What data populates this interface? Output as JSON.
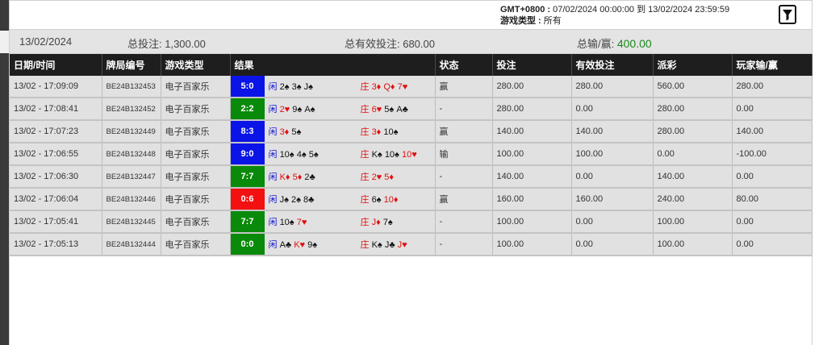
{
  "header": {
    "timezone_label": "GMT+0800 :",
    "date_range": "07/02/2024 00:00:00 到 13/02/2024 23:59:59",
    "game_type_label": "游戏类型 :",
    "game_type_value": "所有"
  },
  "summary": {
    "date": "13/02/2024",
    "total_bet": "总投注: 1,300.00",
    "total_valid_bet": "总有效投注: 680.00",
    "total_winloss_label": "总输/赢:",
    "total_winloss_value": "400.00"
  },
  "columns": [
    "日期/时间",
    "牌局编号",
    "游戏类型",
    "结果",
    "状态",
    "投注",
    "有效投注",
    "派彩",
    "玩家输/赢"
  ],
  "colors": {
    "blue": "#0a14e6",
    "green": "#0a8a0a",
    "red": "#f21010"
  },
  "rows": [
    {
      "time": "13/02 - 17:09:09",
      "round": "BE24B132453",
      "game": "电子百家乐",
      "score": "5:0",
      "scoreColor": "blue",
      "player": [
        {
          "t": "闲",
          "c": "p"
        },
        {
          "t": "2♠",
          "c": "b"
        },
        {
          "t": "3♠",
          "c": "b"
        },
        {
          "t": "J♠",
          "c": "b"
        }
      ],
      "banker": [
        {
          "t": "庄",
          "c": "r"
        },
        {
          "t": "3♦",
          "c": "r"
        },
        {
          "t": "Q♦",
          "c": "r"
        },
        {
          "t": "7♥",
          "c": "r"
        }
      ],
      "status": "赢",
      "statusType": "win",
      "bet": "280.00",
      "valid": "280.00",
      "payout": "560.00",
      "wl": "280.00",
      "wlType": "pos"
    },
    {
      "time": "13/02 - 17:08:41",
      "round": "BE24B132452",
      "game": "电子百家乐",
      "score": "2:2",
      "scoreColor": "green",
      "player": [
        {
          "t": "闲",
          "c": "p"
        },
        {
          "t": "2♥",
          "c": "r"
        },
        {
          "t": "9♠",
          "c": "b"
        },
        {
          "t": "A♠",
          "c": "b"
        }
      ],
      "banker": [
        {
          "t": "庄",
          "c": "r"
        },
        {
          "t": "6♥",
          "c": "r"
        },
        {
          "t": "5♠",
          "c": "b"
        },
        {
          "t": "A♣",
          "c": "b"
        }
      ],
      "status": "-",
      "statusType": "none",
      "bet": "280.00",
      "valid": "0.00",
      "payout": "280.00",
      "wl": "0.00",
      "wlType": "ref"
    },
    {
      "time": "13/02 - 17:07:23",
      "round": "BE24B132449",
      "game": "电子百家乐",
      "score": "8:3",
      "scoreColor": "blue",
      "player": [
        {
          "t": "闲",
          "c": "p"
        },
        {
          "t": "3♦",
          "c": "r"
        },
        {
          "t": "5♠",
          "c": "b"
        }
      ],
      "banker": [
        {
          "t": "庄",
          "c": "r"
        },
        {
          "t": "3♦",
          "c": "r"
        },
        {
          "t": "10♠",
          "c": "b"
        }
      ],
      "status": "赢",
      "statusType": "win",
      "bet": "140.00",
      "valid": "140.00",
      "payout": "280.00",
      "wl": "140.00",
      "wlType": "pos"
    },
    {
      "time": "13/02 - 17:06:55",
      "round": "BE24B132448",
      "game": "电子百家乐",
      "score": "9:0",
      "scoreColor": "blue",
      "player": [
        {
          "t": "闲",
          "c": "p"
        },
        {
          "t": "10♠",
          "c": "b"
        },
        {
          "t": "4♠",
          "c": "b"
        },
        {
          "t": "5♠",
          "c": "b"
        }
      ],
      "banker": [
        {
          "t": "庄",
          "c": "r"
        },
        {
          "t": "K♠",
          "c": "b"
        },
        {
          "t": "10♠",
          "c": "b"
        },
        {
          "t": "10♥",
          "c": "r"
        }
      ],
      "status": "输",
      "statusType": "lose",
      "bet": "100.00",
      "valid": "100.00",
      "payout": "0.00",
      "wl": "-100.00",
      "wlType": "neg"
    },
    {
      "time": "13/02 - 17:06:30",
      "round": "BE24B132447",
      "game": "电子百家乐",
      "score": "7:7",
      "scoreColor": "green",
      "player": [
        {
          "t": "闲",
          "c": "p"
        },
        {
          "t": "K♦",
          "c": "r"
        },
        {
          "t": "5♦",
          "c": "r"
        },
        {
          "t": "2♣",
          "c": "b"
        }
      ],
      "banker": [
        {
          "t": "庄",
          "c": "r"
        },
        {
          "t": "2♥",
          "c": "r"
        },
        {
          "t": "5♦",
          "c": "r"
        }
      ],
      "status": "-",
      "statusType": "none",
      "bet": "140.00",
      "valid": "0.00",
      "payout": "140.00",
      "wl": "0.00",
      "wlType": "ref"
    },
    {
      "time": "13/02 - 17:06:04",
      "round": "BE24B132446",
      "game": "电子百家乐",
      "score": "0:6",
      "scoreColor": "red",
      "player": [
        {
          "t": "闲",
          "c": "p"
        },
        {
          "t": "J♠",
          "c": "b"
        },
        {
          "t": "2♠",
          "c": "b"
        },
        {
          "t": "8♣",
          "c": "b"
        }
      ],
      "banker": [
        {
          "t": "庄",
          "c": "r"
        },
        {
          "t": "6♠",
          "c": "b"
        },
        {
          "t": "10♦",
          "c": "r"
        }
      ],
      "status": "赢",
      "statusType": "win",
      "bet": "160.00",
      "valid": "160.00",
      "payout": "240.00",
      "wl": "80.00",
      "wlType": "pos"
    },
    {
      "time": "13/02 - 17:05:41",
      "round": "BE24B132445",
      "game": "电子百家乐",
      "score": "7:7",
      "scoreColor": "green",
      "player": [
        {
          "t": "闲",
          "c": "p"
        },
        {
          "t": "10♠",
          "c": "b"
        },
        {
          "t": "7♥",
          "c": "r"
        }
      ],
      "banker": [
        {
          "t": "庄",
          "c": "r"
        },
        {
          "t": "J♦",
          "c": "r"
        },
        {
          "t": "7♠",
          "c": "b"
        }
      ],
      "status": "-",
      "statusType": "none",
      "bet": "100.00",
      "valid": "0.00",
      "payout": "100.00",
      "wl": "0.00",
      "wlType": "ref"
    },
    {
      "time": "13/02 - 17:05:13",
      "round": "BE24B132444",
      "game": "电子百家乐",
      "score": "0:0",
      "scoreColor": "green",
      "player": [
        {
          "t": "闲",
          "c": "p"
        },
        {
          "t": "A♣",
          "c": "b"
        },
        {
          "t": "K♥",
          "c": "r"
        },
        {
          "t": "9♠",
          "c": "b"
        }
      ],
      "banker": [
        {
          "t": "庄",
          "c": "r"
        },
        {
          "t": "K♠",
          "c": "b"
        },
        {
          "t": "J♣",
          "c": "b"
        },
        {
          "t": "J♥",
          "c": "r"
        }
      ],
      "status": "-",
      "statusType": "none",
      "bet": "100.00",
      "valid": "0.00",
      "payout": "100.00",
      "wl": "0.00",
      "wlType": "ref"
    }
  ]
}
